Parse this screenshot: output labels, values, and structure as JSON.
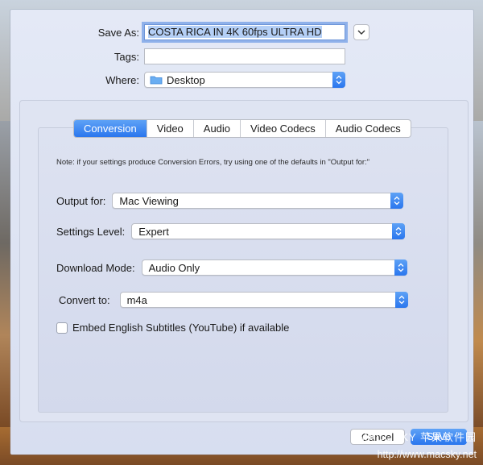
{
  "save_panel": {
    "save_as_label": "Save As:",
    "save_as_value": "COSTA RICA IN 4K 60fps ULTRA HD",
    "tags_label": "Tags:",
    "tags_value": "",
    "where_label": "Where:",
    "where_value": "Desktop"
  },
  "tabs": [
    "Conversion",
    "Video",
    "Audio",
    "Video Codecs",
    "Audio Codecs"
  ],
  "active_tab": "Conversion",
  "conversion": {
    "note": "Note: if your settings produce Conversion Errors, try using one of the defaults in \"Output for:\"",
    "output_for_label": "Output for:",
    "output_for_value": "Mac Viewing",
    "settings_level_label": "Settings Level:",
    "settings_level_value": "Expert",
    "download_mode_label": "Download Mode:",
    "download_mode_value": "Audio Only",
    "convert_to_label": "Convert to:",
    "convert_to_value": "m4a",
    "embed_subtitles_label": "Embed English Subtitles (YouTube) if available",
    "embed_subtitles_checked": false
  },
  "buttons": {
    "cancel": "Cancel",
    "save": "Save"
  },
  "watermark": {
    "line1": "MACOSKY 苹果软件园",
    "line2": "http://www.macsky.net"
  },
  "colors": {
    "accent": "#2a76ee",
    "focus_ring": "#8fb1ea"
  }
}
